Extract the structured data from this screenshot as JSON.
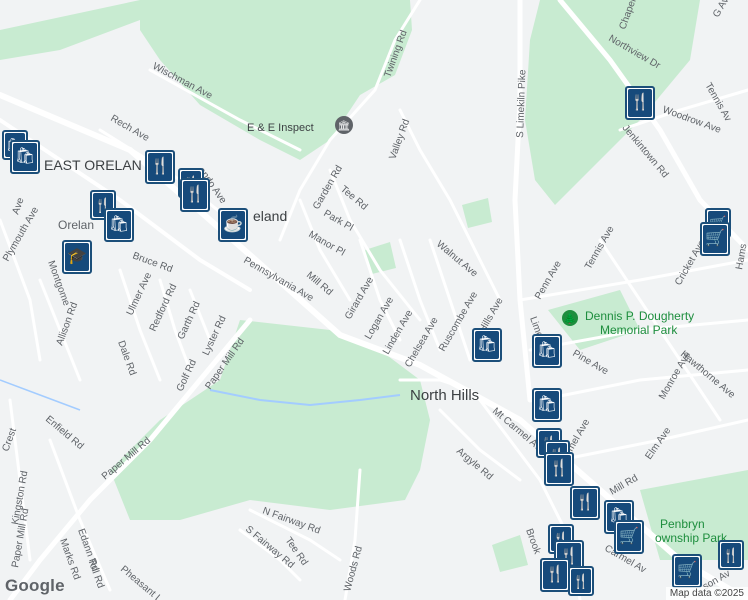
{
  "map": {
    "places": {
      "east_oreland": "EAST ORELAN",
      "oreland_small": "Orelan",
      "oreland_big": "eland",
      "north_hills": "North Hills"
    },
    "pois": {
      "ee_inspect": "E & E Inspect",
      "dougherty_park_1": "Dennis P. Dougherty",
      "dougherty_park_2": "Memorial Park",
      "penbryn_park_1": "Penbryn",
      "penbryn_park_2": "ownship Park"
    },
    "roads": {
      "wischman": "Wischman Ave",
      "rech": "Rech Ave",
      "twining": "Twining Rd",
      "valley": "Valley Rd",
      "limekiln": "S Limekiln Pike",
      "chapel": "Chapel R",
      "northview": "Northview Dr",
      "woodrow": "Woodrow Ave",
      "jenkintown": "Jenkintown Rd",
      "tennis_top": "Tennis Av",
      "gave": "G Ave",
      "garden": "Garden Rd",
      "tee_top": "Tee Rd",
      "park_pl": "Park Pl",
      "manor_pl": "Manor Pl",
      "mill": "Mill Rd",
      "girard": "Girard Ave",
      "logan": "Logan Ave",
      "linden": "Linden Ave",
      "chelsea": "Chelsea Ave",
      "walnut": "Walnut Ave",
      "ruscombe": "Ruscombe Ave",
      "hills": "Hills Ave",
      "penn": "Penn Ave",
      "tennis": "Tennis Ave",
      "cricket": "Cricket Ave",
      "hams": "Hams",
      "lime": "Lime",
      "pine": "Pine Ave",
      "monroe": "Monroe Ave",
      "hawthorne": "Hawthorne Ave",
      "elm": "Elm Ave",
      "mel": "mel Ave",
      "mt_carmel": "Mt Carmel Av",
      "mill_right": "Mill Rd",
      "argyle": "Argyle Rd",
      "brook": "Brook",
      "carmel_bottom": "Carmel Av",
      "son": "son Av",
      "pennsylvania": "Pennsylvania Ave",
      "bruce": "Bruce Rd",
      "ulmer": "Ulmer Ave",
      "redford": "Redford Rd",
      "garth": "Garth Rd",
      "lyster": "Lyster Rd",
      "golf": "Golf Rd",
      "paper_mill_1": "Paper Mill Rd",
      "paper_mill_2": "Paper Mill Rd",
      "paper_mill_3": "Paper Mill Rd",
      "dale": "Dale Rd",
      "allison": "Allison Rd",
      "montgomery": "Montgome",
      "plymouth": "Plymouth Ave",
      "ave_left": "Ave",
      "enfield": "Enfield Rd",
      "crest": "Crest",
      "kingston": "Kingston Rd",
      "edann": "Edann Rd",
      "marks": "Marks Rd",
      "toll": "Toll Rd",
      "pheasant": "Pheasant L",
      "n_fairway": "N Fairway Rd",
      "s_fairway": "S Fairway Rd",
      "tee_bottom": "Tee Rd",
      "woods": "Woods Rd",
      "orlando": "ando Ave"
    },
    "attribution": "Map data ©2025",
    "logo": "Google"
  },
  "pins": [
    {
      "kind": "shopping",
      "glyph": "🛍"
    },
    {
      "kind": "shopping",
      "glyph": "🛍"
    },
    {
      "kind": "restaurant",
      "glyph": "🍴"
    },
    {
      "kind": "restaurant",
      "glyph": "🍴"
    },
    {
      "kind": "restaurant",
      "glyph": "🍴"
    },
    {
      "kind": "restaurant",
      "glyph": "🍴"
    },
    {
      "kind": "shopping",
      "glyph": "🛍"
    },
    {
      "kind": "cafe",
      "glyph": "☕"
    },
    {
      "kind": "school",
      "glyph": "🎓"
    },
    {
      "kind": "restaurant",
      "glyph": "🍴"
    },
    {
      "kind": "grocery",
      "glyph": "🛒"
    },
    {
      "kind": "grocery",
      "glyph": "🛒"
    },
    {
      "kind": "shopping",
      "glyph": "🛍"
    },
    {
      "kind": "shopping",
      "glyph": "🛍"
    },
    {
      "kind": "shopping",
      "glyph": "🛍"
    },
    {
      "kind": "restaurant",
      "glyph": "🍴"
    },
    {
      "kind": "restaurant",
      "glyph": "🍴"
    },
    {
      "kind": "restaurant",
      "glyph": "🍴"
    },
    {
      "kind": "restaurant",
      "glyph": "🍴"
    },
    {
      "kind": "restaurant",
      "glyph": "🍴"
    },
    {
      "kind": "shopping",
      "glyph": "🛍"
    },
    {
      "kind": "grocery",
      "glyph": "🛒"
    },
    {
      "kind": "restaurant",
      "glyph": "🍴"
    },
    {
      "kind": "restaurant",
      "glyph": "🍴"
    },
    {
      "kind": "restaurant",
      "glyph": "🍴"
    },
    {
      "kind": "grocery",
      "glyph": "🛒"
    },
    {
      "kind": "restaurant",
      "glyph": "🍴"
    }
  ],
  "colors": {
    "land": "#f1f3f4",
    "park": "#c8ebd1",
    "water": "#a3ccff",
    "road": "#ffffff",
    "pin_border": "#1c4f7a",
    "pin_fill": "#164a7b"
  }
}
